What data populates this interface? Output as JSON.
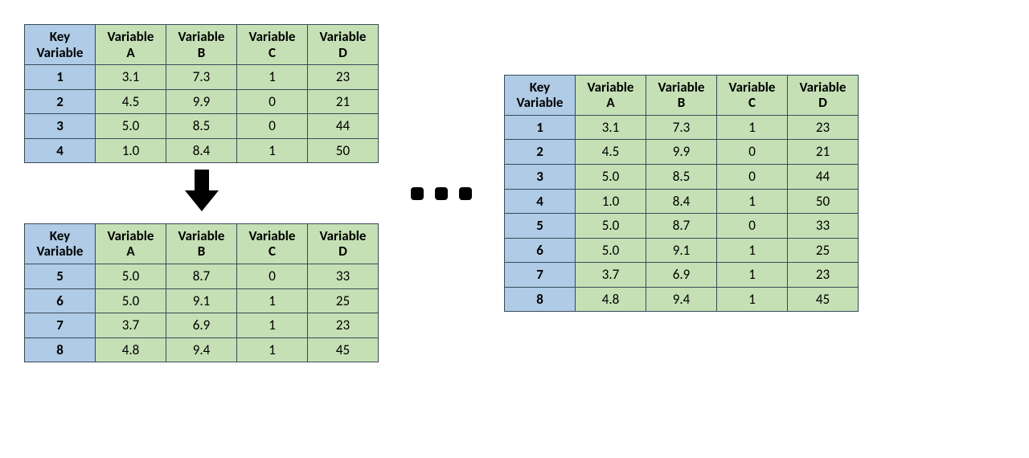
{
  "headers": {
    "key": "Key\nVariable",
    "a": "Variable\nA",
    "b": "Variable\nB",
    "c": "Variable\nC",
    "d": "Variable\nD"
  },
  "tableTop": {
    "rows": [
      {
        "key": "1",
        "a": "3.1",
        "b": "7.3",
        "c": "1",
        "d": "23"
      },
      {
        "key": "2",
        "a": "4.5",
        "b": "9.9",
        "c": "0",
        "d": "21"
      },
      {
        "key": "3",
        "a": "5.0",
        "b": "8.5",
        "c": "0",
        "d": "44"
      },
      {
        "key": "4",
        "a": "1.0",
        "b": "8.4",
        "c": "1",
        "d": "50"
      }
    ]
  },
  "tableBottom": {
    "rows": [
      {
        "key": "5",
        "a": "5.0",
        "b": "8.7",
        "c": "0",
        "d": "33"
      },
      {
        "key": "6",
        "a": "5.0",
        "b": "9.1",
        "c": "1",
        "d": "25"
      },
      {
        "key": "7",
        "a": "3.7",
        "b": "6.9",
        "c": "1",
        "d": "23"
      },
      {
        "key": "8",
        "a": "4.8",
        "b": "9.4",
        "c": "1",
        "d": "45"
      }
    ]
  },
  "tableMerged": {
    "rows": [
      {
        "key": "1",
        "a": "3.1",
        "b": "7.3",
        "c": "1",
        "d": "23"
      },
      {
        "key": "2",
        "a": "4.5",
        "b": "9.9",
        "c": "0",
        "d": "21"
      },
      {
        "key": "3",
        "a": "5.0",
        "b": "8.5",
        "c": "0",
        "d": "44"
      },
      {
        "key": "4",
        "a": "1.0",
        "b": "8.4",
        "c": "1",
        "d": "50"
      },
      {
        "key": "5",
        "a": "5.0",
        "b": "8.7",
        "c": "0",
        "d": "33"
      },
      {
        "key": "6",
        "a": "5.0",
        "b": "9.1",
        "c": "1",
        "d": "25"
      },
      {
        "key": "7",
        "a": "3.7",
        "b": "6.9",
        "c": "1",
        "d": "23"
      },
      {
        "key": "8",
        "a": "4.8",
        "b": "9.4",
        "c": "1",
        "d": "45"
      }
    ]
  }
}
